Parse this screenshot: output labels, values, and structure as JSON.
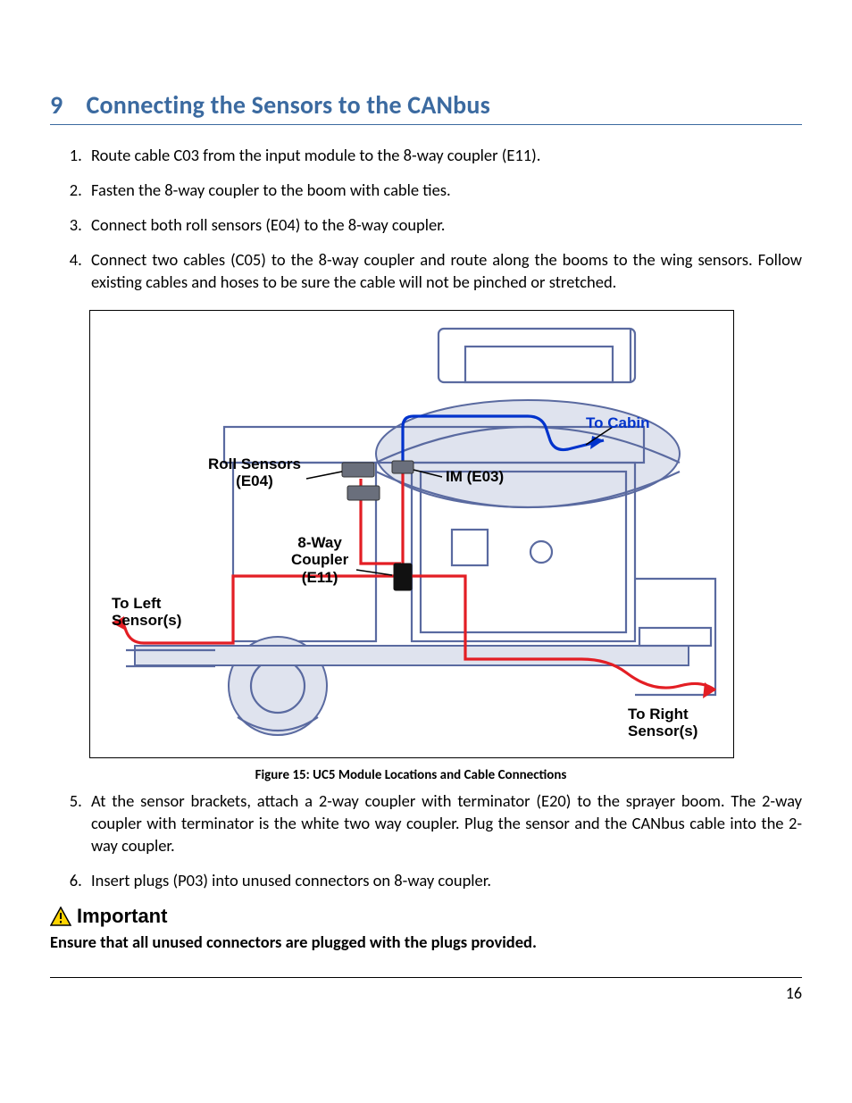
{
  "heading": {
    "number": "9",
    "title": "Connecting the Sensors to the CANbus"
  },
  "steps": [
    "Route cable C03 from the input module to the 8-way coupler (E11).",
    "Fasten the 8-way coupler to the boom with cable ties.",
    "Connect both roll sensors (E04) to the 8-way coupler.",
    "Connect two cables (C05) to the 8-way coupler and route along the booms to the wing sensors.  Follow existing cables and hoses to be sure the cable will not be pinched or stretched."
  ],
  "figure": {
    "caption": "Figure 15:  UC5 Module Locations and Cable Connections",
    "labels": {
      "to_cabin": "To Cabin",
      "roll_sensors": "Roll Sensors\n(E04)",
      "im": "IM (E03)",
      "coupler": "8-Way\nCoupler\n(E11)",
      "to_left": "To Left\nSensor(s)",
      "to_right": "To Right\nSensor(s)"
    }
  },
  "steps_after": [
    "At the sensor brackets, attach a 2-way coupler with terminator (E20) to the sprayer boom.  The 2-way coupler with terminator is the white two way coupler.  Plug the sensor and the CANbus cable into the 2-way coupler.",
    "Insert plugs (P03) into unused connectors on 8-way coupler."
  ],
  "important": {
    "label": "Important",
    "body": "Ensure that all unused connectors are plugged with the plugs provided."
  },
  "page_number": "16"
}
